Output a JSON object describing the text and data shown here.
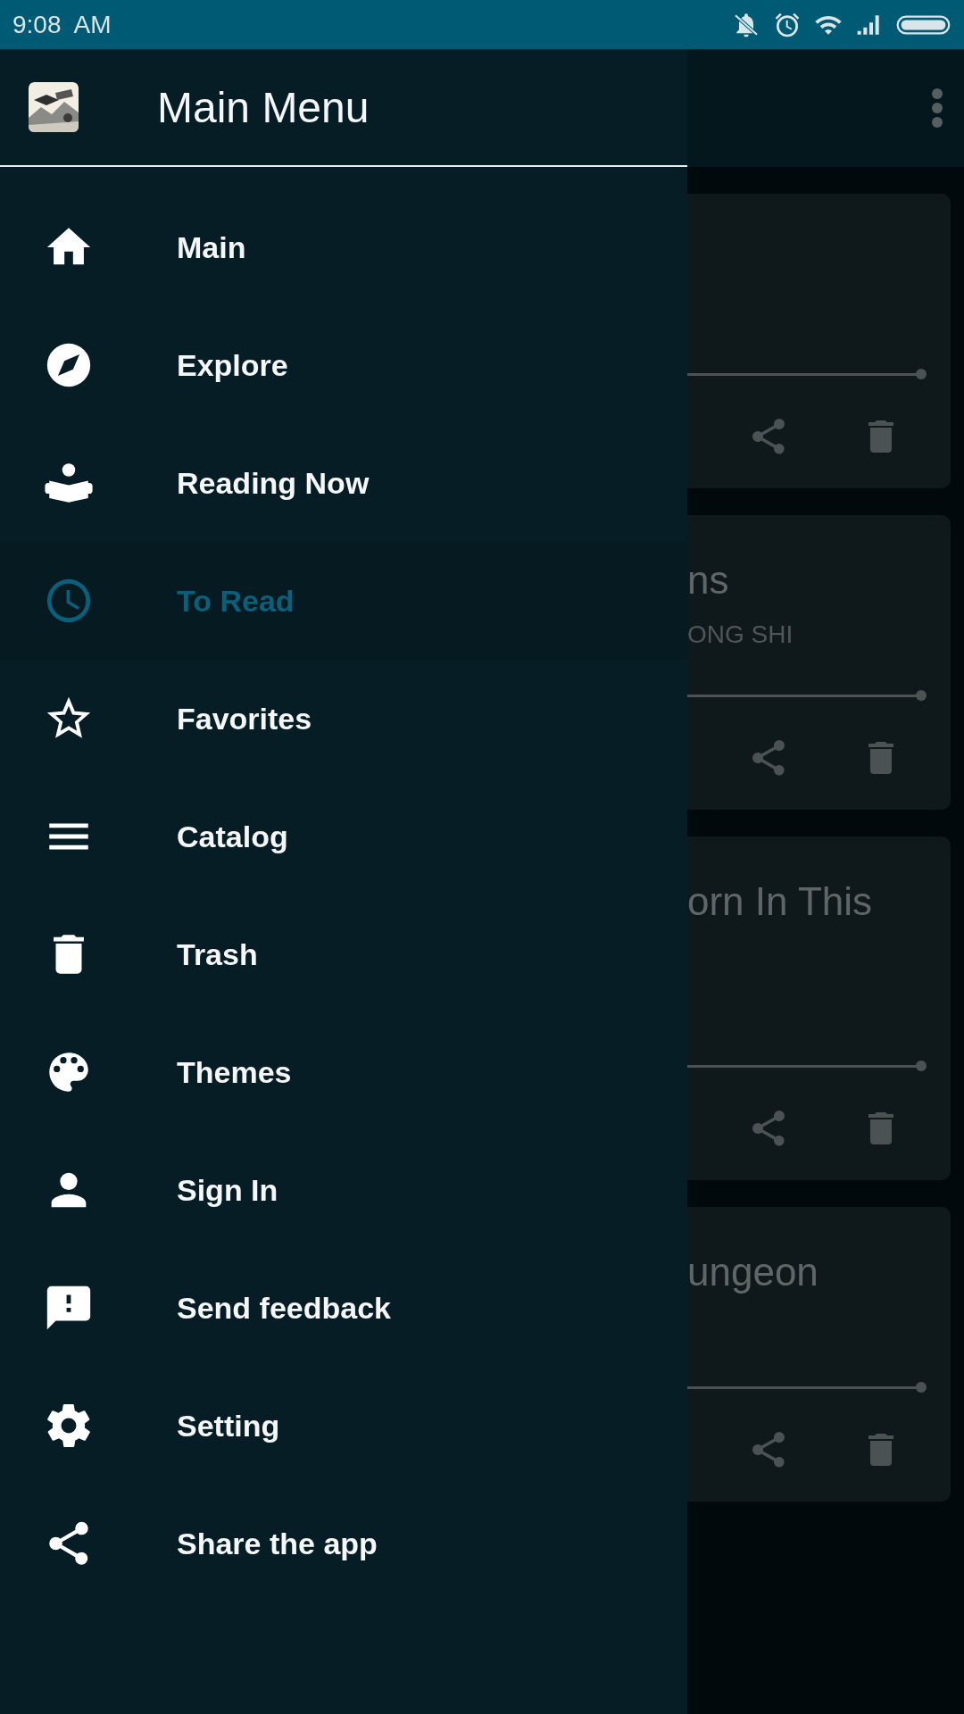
{
  "status_bar": {
    "time": "9:08  AM"
  },
  "background": {
    "cards": [
      {
        "level": 1
      },
      {
        "title": "ns",
        "subtitle": "ONG SHI",
        "level": 1
      },
      {
        "title": "orn In This",
        "level": 1
      },
      {
        "title": "ungeon",
        "level": 1
      }
    ]
  },
  "drawer": {
    "header": {
      "title": "Main Menu"
    },
    "items": [
      {
        "kind": "home",
        "label": "Main",
        "selected": false
      },
      {
        "kind": "compass",
        "label": "Explore",
        "selected": false
      },
      {
        "kind": "reader",
        "label": "Reading Now",
        "selected": false
      },
      {
        "kind": "clock",
        "label": "To Read",
        "selected": true
      },
      {
        "kind": "star",
        "label": "Favorites",
        "selected": false
      },
      {
        "kind": "lines",
        "label": "Catalog",
        "selected": false
      },
      {
        "kind": "trash",
        "label": "Trash",
        "selected": false
      },
      {
        "kind": "palette",
        "label": "Themes",
        "selected": false
      },
      {
        "kind": "person",
        "label": "Sign In",
        "selected": false
      },
      {
        "kind": "feedback",
        "label": "Send feedback",
        "selected": false
      },
      {
        "kind": "gear",
        "label": "Setting",
        "selected": false
      },
      {
        "kind": "share",
        "label": "Share the app",
        "selected": false
      }
    ]
  }
}
